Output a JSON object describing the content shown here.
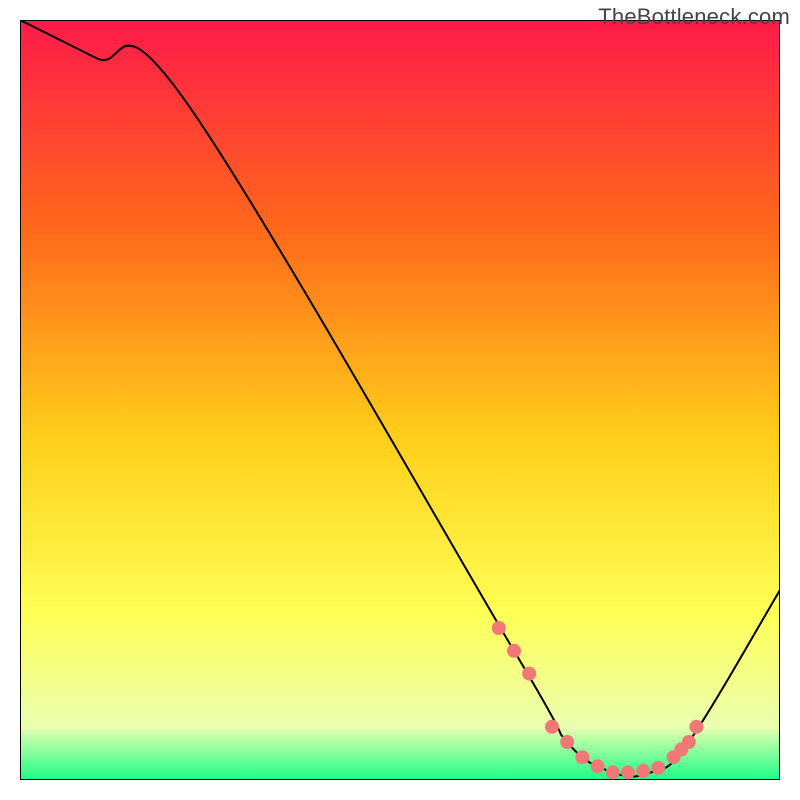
{
  "watermark": "TheBottleneck.com",
  "chart_data": {
    "type": "line",
    "title": "",
    "xlabel": "",
    "ylabel": "",
    "xlim": [
      0,
      100
    ],
    "ylim": [
      0,
      100
    ],
    "background_gradient": {
      "top": "#ff1a4a",
      "mid_upper": "#ff6a1a",
      "mid": "#ffcf1a",
      "mid_lower": "#ffff55",
      "bottom": "#1aff88"
    },
    "series": [
      {
        "name": "bottleneck-curve",
        "x": [
          0,
          10,
          22,
          65,
          72,
          78,
          83,
          88,
          100
        ],
        "y": [
          100,
          95,
          89,
          17,
          5,
          1,
          1,
          5,
          25
        ],
        "stroke": "#000000",
        "stroke_width": 2
      }
    ],
    "markers": {
      "name": "highlighted-points",
      "x": [
        63,
        65,
        67,
        70,
        72,
        74,
        76,
        78,
        80,
        82,
        84,
        86,
        87,
        88,
        89
      ],
      "y": [
        20,
        17,
        14,
        7,
        5,
        3,
        1.8,
        1,
        1,
        1.2,
        1.6,
        3,
        4,
        5,
        7
      ],
      "color": "#f27878",
      "radius": 7
    }
  }
}
